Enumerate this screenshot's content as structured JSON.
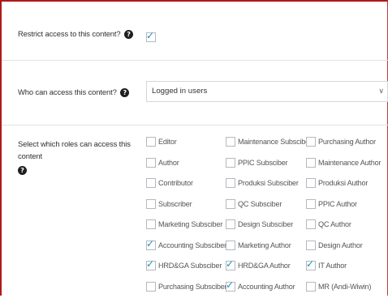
{
  "restrict": {
    "label": "Restrict access to this content?",
    "help_icon": "question-circle-icon",
    "checked": true
  },
  "who_can_access": {
    "label": "Who can access this content?",
    "help_icon": "question-circle-icon",
    "selected_value": "Logged in users",
    "chevron_icon": "chevron-down-icon"
  },
  "roles": {
    "label": "Select which roles can access this content",
    "help_icon": "question-circle-icon",
    "columns": [
      [
        {
          "label": "Editor",
          "checked": false
        },
        {
          "label": "Author",
          "checked": false
        },
        {
          "label": "Contributor",
          "checked": false
        },
        {
          "label": "Subscriber",
          "checked": false
        },
        {
          "label": "Marketing Subsciber",
          "checked": false
        },
        {
          "label": "Accounting Subsciber",
          "checked": true
        },
        {
          "label": "HRD&GA Subsciber",
          "checked": true
        },
        {
          "label": "Purchasing Subsciber",
          "checked": false
        }
      ],
      [
        {
          "label": "Maintenance Subsciber",
          "checked": false
        },
        {
          "label": "PPIC Subsciber",
          "checked": false
        },
        {
          "label": "Produksi Subsciber",
          "checked": false
        },
        {
          "label": "QC Subsciber",
          "checked": false
        },
        {
          "label": "Design Subsciber",
          "checked": false
        },
        {
          "label": "Marketing Author",
          "checked": false
        },
        {
          "label": "HRD&GA Author",
          "checked": true
        },
        {
          "label": "Accounting Author",
          "checked": true
        }
      ],
      [
        {
          "label": "Purchasing Author",
          "checked": false
        },
        {
          "label": "Maintenance Author",
          "checked": false
        },
        {
          "label": "Produksi Author",
          "checked": false
        },
        {
          "label": "PPIC Author",
          "checked": false
        },
        {
          "label": "QC Author",
          "checked": false
        },
        {
          "label": "Design Author",
          "checked": false
        },
        {
          "label": "IT Author",
          "checked": true
        },
        {
          "label": "MR (Andi-Wiwin)",
          "checked": false
        }
      ]
    ]
  },
  "colors": {
    "frame_border": "#b01818",
    "checkmark": "#1e8cbe"
  }
}
